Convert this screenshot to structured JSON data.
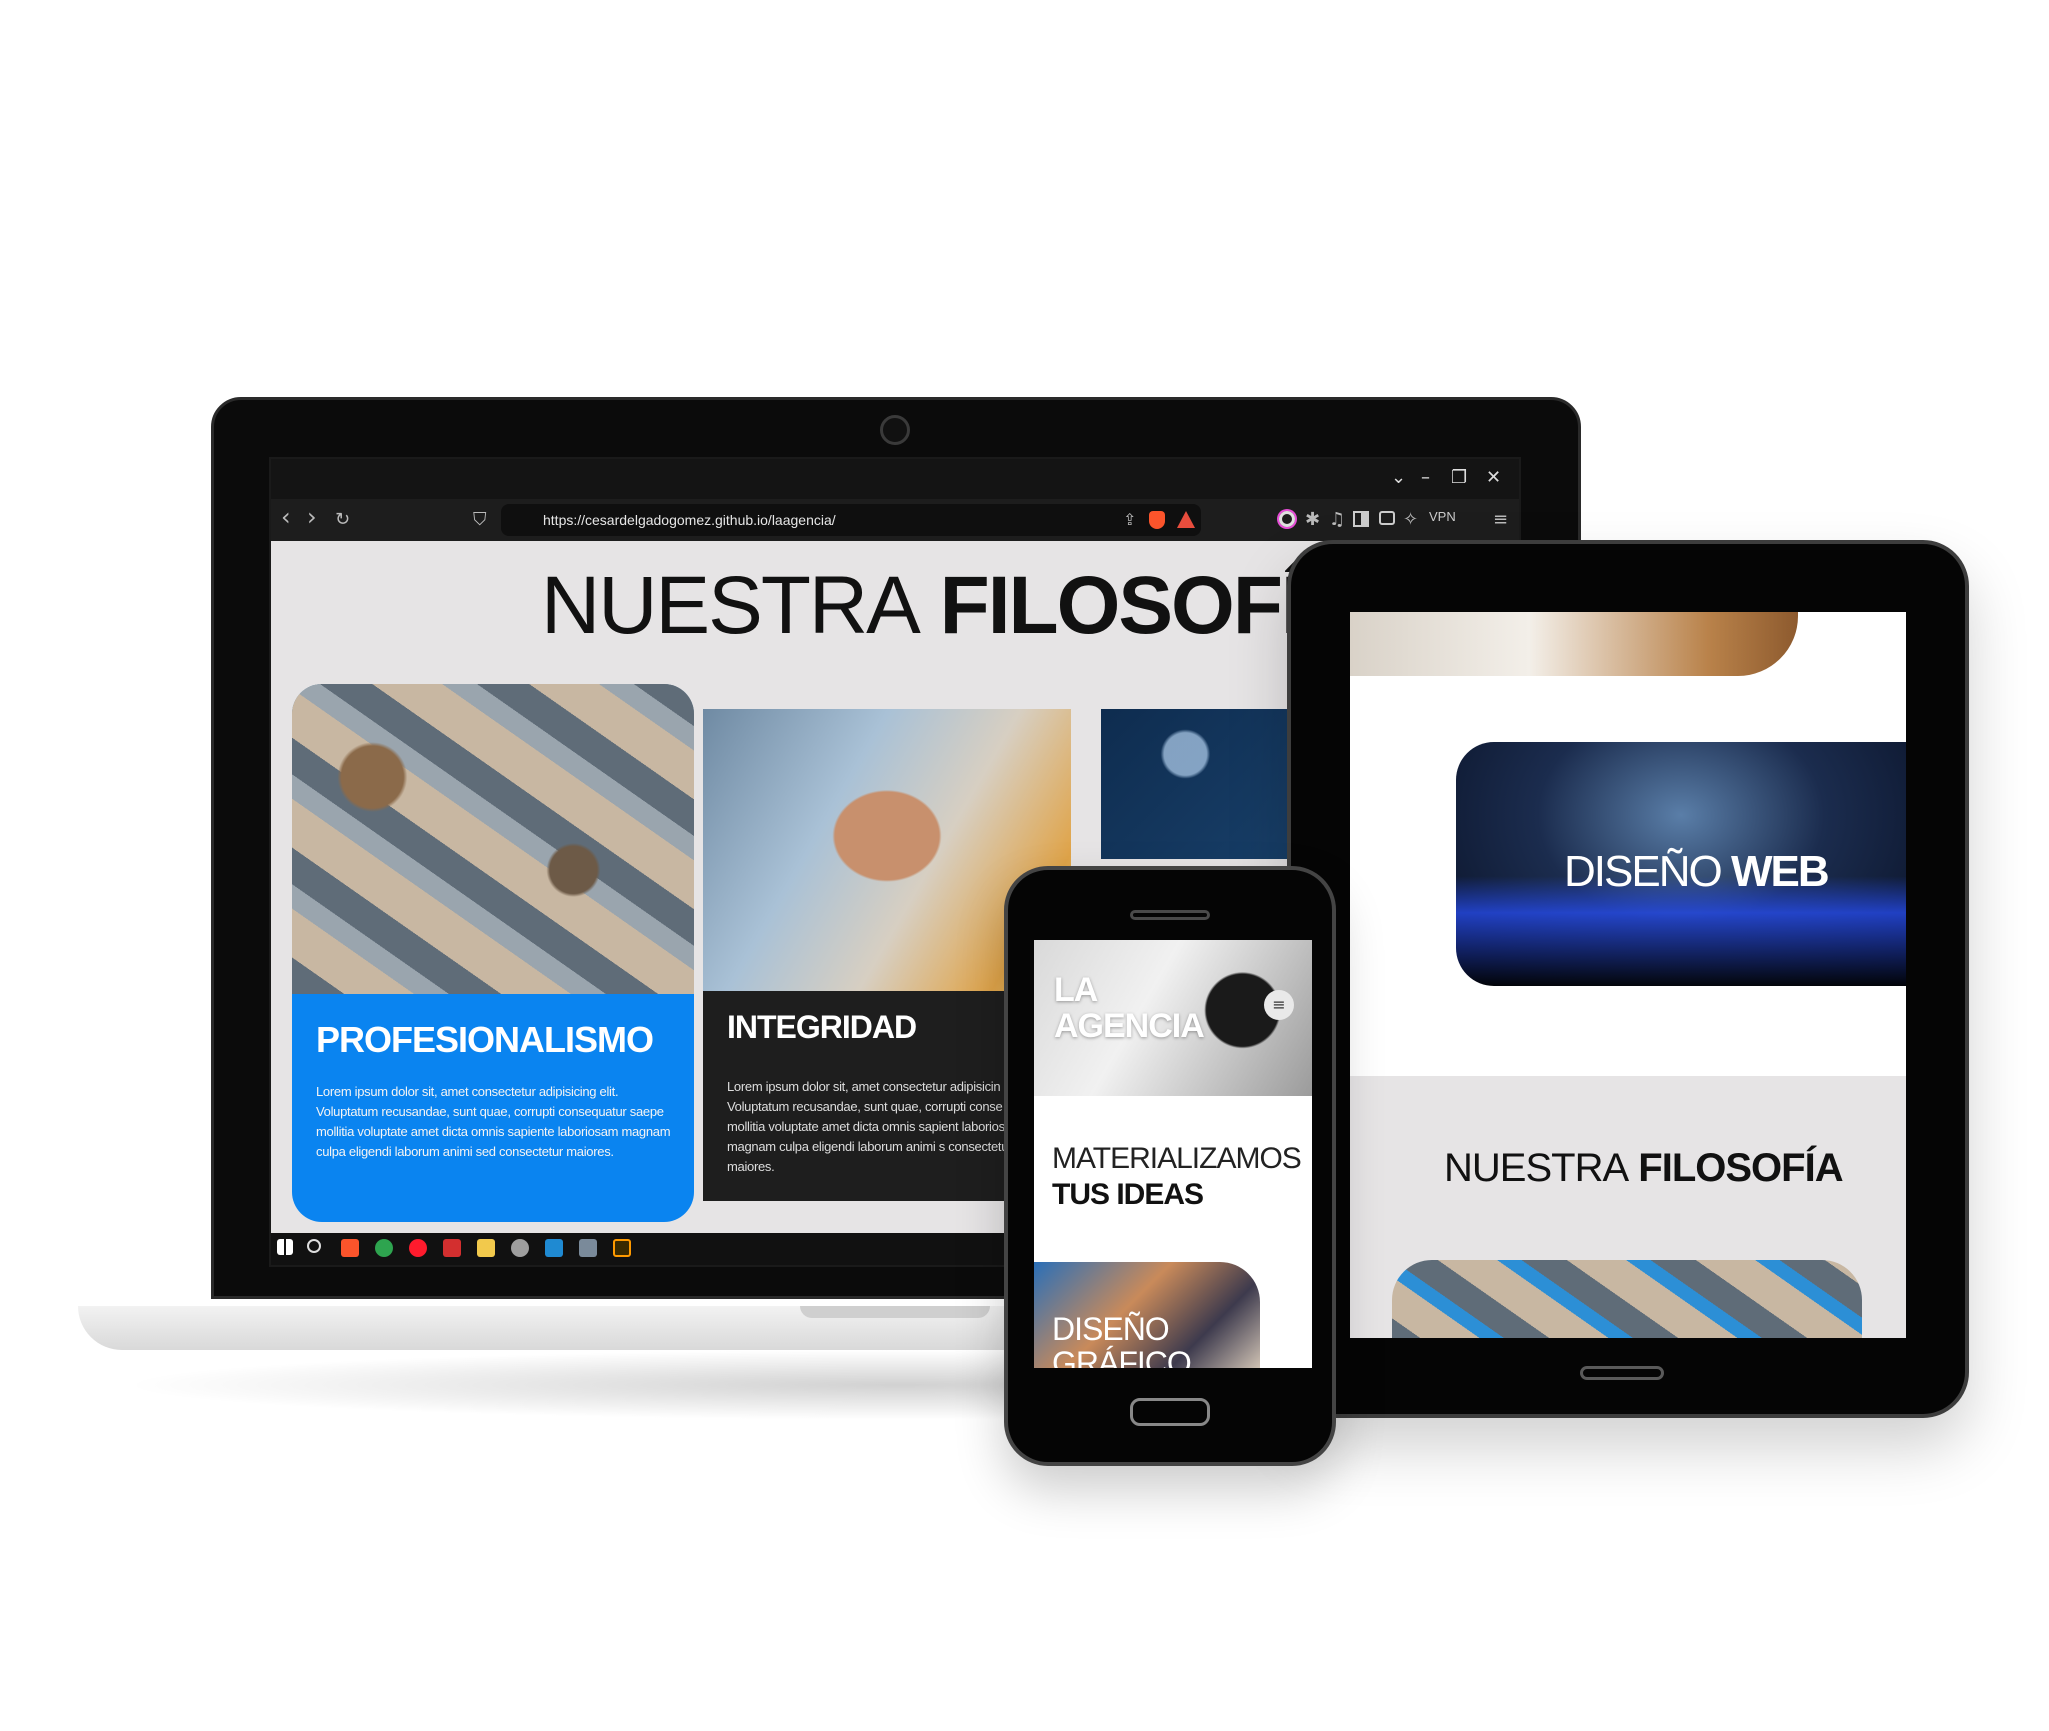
{
  "laptop": {
    "window_controls": [
      "⌄",
      "–",
      "❐",
      "✕"
    ],
    "toolbar": {
      "back": "‹",
      "forward": "›",
      "reload": "↻",
      "bookmark": "⛉",
      "url": "https://cesardelgadogomez.github.io/laagencia/",
      "vpn_label": "VPN"
    },
    "page": {
      "title_light": "NUESTRA",
      "title_bold": "FILOSOFÍA",
      "cards": [
        {
          "heading": "PROFESIONALISMO",
          "body": "Lorem ipsum dolor sit, amet consectetur adipisicing elit. Voluptatum recusandae, sunt quae, corrupti consequatur saepe mollitia voluptate amet dicta omnis sapiente laboriosam magnam culpa eligendi laborum animi sed consectetur maiores."
        },
        {
          "heading": "INTEGRIDAD",
          "body": "Lorem ipsum dolor sit, amet consectetur adipisicin Voluptatum recusandae, sunt quae, corrupti conse saepe mollitia voluptate amet dicta omnis sapient laboriosam magnam culpa eligendi laborum animi s consectetur maiores."
        }
      ]
    }
  },
  "tablet": {
    "service_title_light": "DISEÑO",
    "service_title_bold": "WEB",
    "section_title_light": "NUESTRA",
    "section_title_bold": "FILOSOFÍA"
  },
  "phone": {
    "hero_title_line1": "LA",
    "hero_title_line2": "AGENCIA",
    "menu_icon": "≡",
    "tagline_light": "MATERIALIZAMOS",
    "tagline_bold": "TUS IDEAS",
    "service_title_line1": "DISEÑO",
    "service_title_line2": "GRÁFICO"
  },
  "colors": {
    "accent_blue": "#0a84f0",
    "dark_card": "#1e1e1e",
    "page_bg": "#e6e4e5"
  }
}
